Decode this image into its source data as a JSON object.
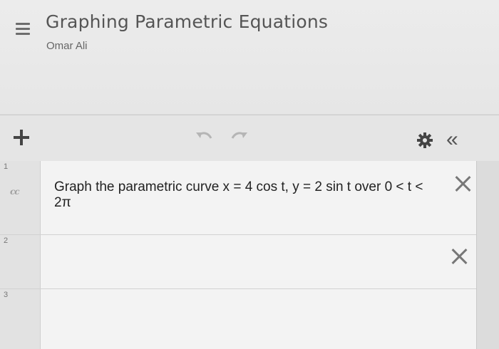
{
  "header": {
    "title": "Graphing Parametric Equations",
    "author": "Omar Ali"
  },
  "toolbar": {
    "icons": [
      "plus-icon",
      "undo-icon",
      "redo-icon",
      "gear-icon",
      "collapse-icon"
    ],
    "collapse_glyph": "«"
  },
  "expressions": [
    {
      "number": "1",
      "text": "Graph the parametric curve x = 4 cos t, y = 2 sin t over 0 < t < 2π",
      "icon": "cc"
    },
    {
      "number": "2",
      "text": ""
    },
    {
      "number": "3",
      "text": ""
    }
  ],
  "colors": {
    "header_bg": "#ececec",
    "toolbar_bg": "#e5e5e5",
    "list_bg": "#f3f3f3",
    "text": "#222222",
    "icon": "#555555"
  }
}
